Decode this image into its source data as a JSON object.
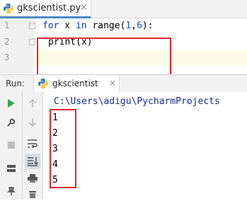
{
  "editor_tab": {
    "filename": "gkscientist.py",
    "close": "×"
  },
  "code": {
    "line_numbers": [
      "1",
      "2",
      "3"
    ],
    "line1": {
      "kw_for": "for",
      "var": " x ",
      "kw_in": "in",
      "call": " range(",
      "n1": "1",
      "comma": ",",
      "n2": "6",
      "end": "):"
    },
    "line2": {
      "text": "print(x)"
    }
  },
  "run_panel": {
    "label": "Run:",
    "tab_name": "gkscientist",
    "close": "×",
    "command_line": "C:\\Users\\adigu\\PycharmProjects",
    "output": [
      "1",
      "2",
      "3",
      "4",
      "5"
    ]
  },
  "colors": {
    "highlight_box": "#e0282e",
    "keyword": "#0033b3",
    "number": "#1750eb",
    "run_green": "#3fa14b"
  }
}
